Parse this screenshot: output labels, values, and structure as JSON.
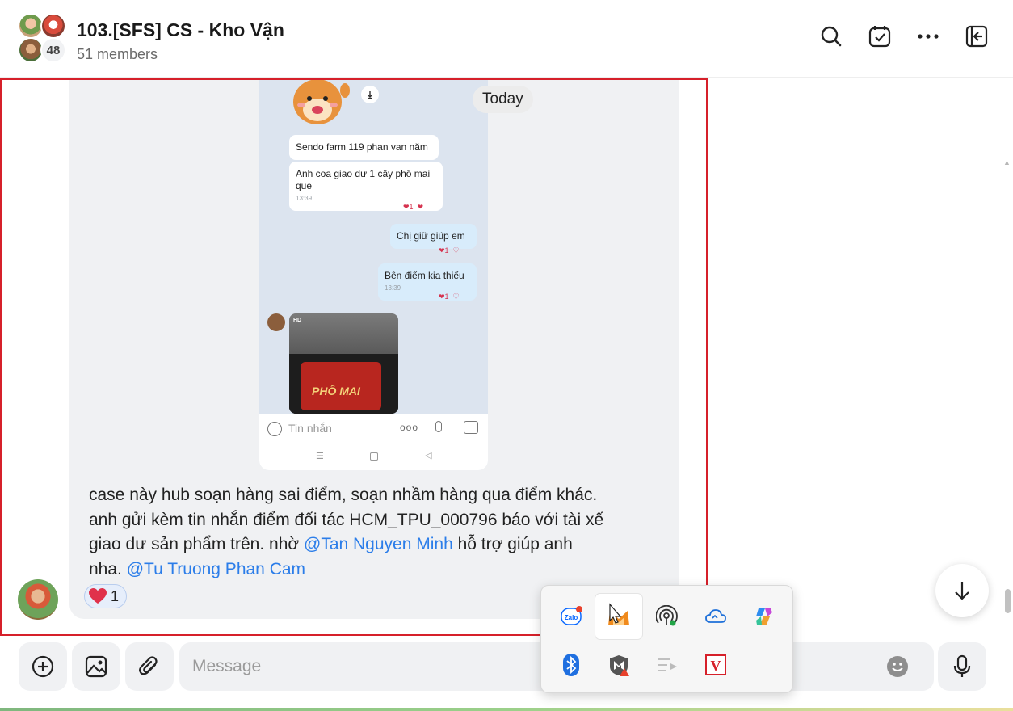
{
  "header": {
    "title": "103.[SFS] CS - Kho Vận",
    "subtitle": "51 members",
    "member_badge": "48",
    "icons": [
      "search-icon",
      "todo-check-icon",
      "more-icon",
      "exit-panel-icon"
    ]
  },
  "chat": {
    "date_divider": "Today",
    "screenshot": {
      "bubbles": [
        {
          "text": "Sendo farm 119 phan van năm",
          "side": "them"
        },
        {
          "text": "Anh coa giao dư 1 cây phô mai que",
          "time": "13:39",
          "side": "them"
        },
        {
          "text": "Chị giữ giúp em",
          "side": "me"
        },
        {
          "text": "Bên điểm kia thiếu",
          "time": "13:39",
          "side": "me"
        }
      ],
      "image_hd_label": "HD",
      "image_text": "PHÔ MAI",
      "input_placeholder": "Tin nhắn",
      "more_dots": "ooo"
    },
    "message": {
      "text_1": "case này hub soạn hàng sai điểm, soạn nhầm hàng qua điểm khác. anh gửi kèm tin nhắn điểm đối tác HCM_TPU_000796 báo với tài xế giao dư sản phẩm trên. nhờ ",
      "mention_1": "@Tan Nguyen Minh",
      "text_2": " hỗ trợ giúp anh nha. ",
      "mention_2": "@Tu Truong Phan Cam",
      "reaction_count": "1"
    }
  },
  "composer": {
    "placeholder": "Message",
    "buttons": [
      "add-icon",
      "image-icon",
      "attach-icon"
    ]
  },
  "tray": {
    "row1": [
      "zalo-icon",
      "fox-app-icon",
      "broadcast-icon",
      "cloud-sync-icon",
      "copilot-icon"
    ],
    "row2": [
      "bluetooth-icon",
      "mcafee-icon",
      "media-icon",
      "vietkey-icon"
    ],
    "zalo_label": "Zalo",
    "vietkey_label": "V"
  },
  "colors": {
    "accent": "#2b7de9",
    "highlight_border": "#d6202a",
    "heart": "#e0314b"
  }
}
